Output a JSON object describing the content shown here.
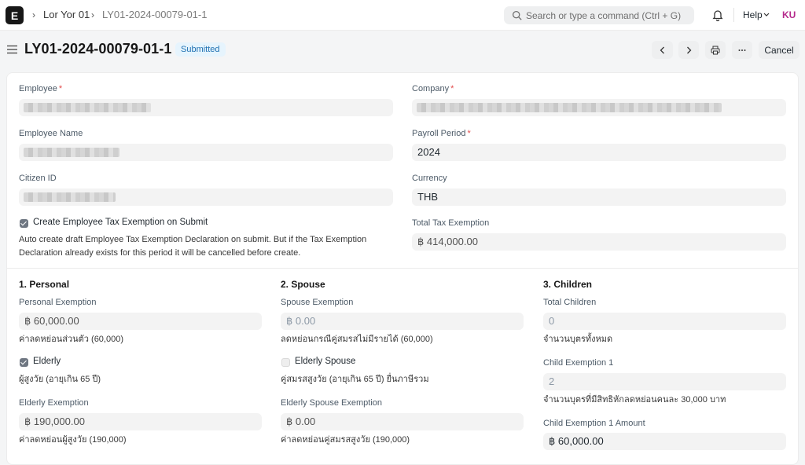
{
  "navbar": {
    "logo_letter": "E",
    "breadcrumbs": [
      "Lor Yor 01",
      "LY01-2024-00079-01-1"
    ],
    "search_placeholder": "Search or type a command (Ctrl + G)",
    "help_label": "Help",
    "avatar_initials": "KU"
  },
  "page": {
    "title": "LY01-2024-00079-01-1",
    "status": "Submitted",
    "cancel_label": "Cancel"
  },
  "form": {
    "employee": {
      "label": "Employee",
      "required": "*"
    },
    "company": {
      "label": "Company",
      "required": "*"
    },
    "employee_name": {
      "label": "Employee Name"
    },
    "payroll_period": {
      "label": "Payroll Period",
      "required": "*",
      "value": "2024"
    },
    "citizen_id": {
      "label": "Citizen ID"
    },
    "currency": {
      "label": "Currency",
      "value": "THB"
    },
    "create_exemption": {
      "label": "Create Employee Tax Exemption on Submit",
      "checked": true,
      "description_1": "Auto create draft Employee Tax Exemption Declaration on submit. But if the Tax Exemption",
      "description_2": "Declaration already exists for this period it will be cancelled before create."
    },
    "total_tax_exemption": {
      "label": "Total Tax Exemption",
      "value": "฿ 414,000.00"
    }
  },
  "sections": {
    "personal": {
      "title": "1. Personal",
      "personal_exemption": {
        "label": "Personal Exemption",
        "value": "฿ 60,000.00",
        "help": "ค่าลดหย่อนส่วนตัว (60,000)"
      },
      "elderly": {
        "label": "Elderly",
        "checked": true,
        "help": "ผู้สูงวัย (อายุเกิน 65 ปี)"
      },
      "elderly_exemption": {
        "label": "Elderly Exemption",
        "value": "฿ 190,000.00",
        "help": "ค่าลดหย่อนผู้สูงวัย (190,000)"
      }
    },
    "spouse": {
      "title": "2. Spouse",
      "spouse_exemption": {
        "label": "Spouse Exemption",
        "value": "฿ 0.00",
        "help": "ลดหย่อนกรณีคู่สมรสไม่มีรายได้ (60,000)"
      },
      "elderly_spouse": {
        "label": "Elderly Spouse",
        "checked": false,
        "help": "คู่สมรสสูงวัย (อายุเกิน 65 ปี) ยื่นภาษีรวม"
      },
      "elderly_spouse_exemption": {
        "label": "Elderly Spouse Exemption",
        "value": "฿ 0.00",
        "help": "ค่าลดหย่อนคู่สมรสสูงวัย (190,000)"
      }
    },
    "children": {
      "title": "3. Children",
      "total_children": {
        "label": "Total Children",
        "value": "0",
        "help": "จำนวนบุตรทั้งหมด"
      },
      "child_exemption_1": {
        "label": "Child Exemption 1",
        "value": "2",
        "help": "จำนวนบุตรที่มีสิทธิหักลดหย่อนคนละ 30,000 บาท"
      },
      "child_exemption_1_amount": {
        "label": "Child Exemption 1 Amount",
        "value": "฿ 60,000.00"
      }
    }
  },
  "icons": {
    "logo": "erpnext-logo-icon",
    "search": "search-icon",
    "bell": "bell-icon",
    "menu": "hamburger-icon",
    "prev": "chevron-left-icon",
    "next": "chevron-right-icon",
    "print": "printer-icon",
    "more": "ellipsis-icon"
  },
  "colors": {
    "badge_bg": "#e6f4fd",
    "badge_text": "#1e70b2",
    "avatar": "#b52a8c",
    "required": "#e24c4c"
  }
}
